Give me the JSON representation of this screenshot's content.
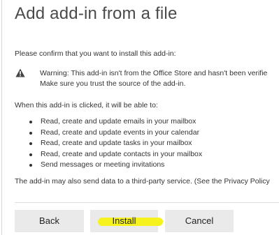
{
  "dialog": {
    "title": "Add add-in from a file",
    "intro": "Please confirm that you want to install this add-in:",
    "warning": {
      "icon": "warning-icon",
      "line1": "Warning: This add-in isn't from the Office Store and hasn't been verifie",
      "line2": "Make sure you trust the source of the add-in."
    },
    "capabilities_intro": "When this add-in is clicked, it will be able to:",
    "capabilities": [
      "Read, create and update emails in your mailbox",
      "Read, create and update events in your calendar",
      "Read, create and update tasks in your mailbox",
      "Read, create and update contacts in your mailbox",
      "Send messages or meeting invitations"
    ],
    "privacy_note": "The add-in may also send data to a third-party service. (See the Privacy Policy"
  },
  "buttons": {
    "back": "Back",
    "install": "Install",
    "cancel": "Cancel"
  },
  "colors": {
    "highlight": "#f6f21d",
    "button_bg": "#eaeaea"
  }
}
